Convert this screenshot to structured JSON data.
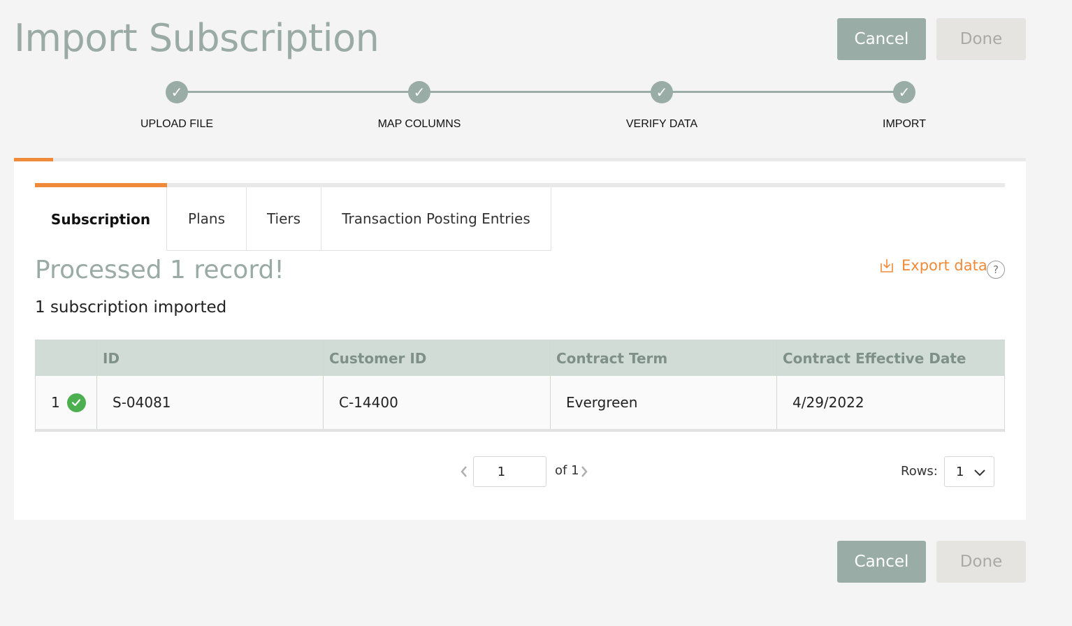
{
  "page": {
    "title": "Import Subscription"
  },
  "actions": {
    "cancel_label": "Cancel",
    "done_label": "Done"
  },
  "stepper": {
    "steps": [
      {
        "label": "UPLOAD FILE",
        "status": "complete"
      },
      {
        "label": "MAP COLUMNS",
        "status": "complete"
      },
      {
        "label": "VERIFY DATA",
        "status": "complete"
      },
      {
        "label": "IMPORT",
        "status": "complete"
      }
    ],
    "check_glyph": "✓"
  },
  "tabs": [
    {
      "label": "Subscription",
      "active": true
    },
    {
      "label": "Plans",
      "active": false
    },
    {
      "label": "Tiers",
      "active": false
    },
    {
      "label": "Transaction Posting Entries",
      "active": false
    }
  ],
  "result": {
    "title": "Processed 1 record!",
    "summary": "1 subscription imported",
    "export_label": "Export data",
    "help_glyph": "?"
  },
  "table": {
    "columns": [
      "ID",
      "Customer ID",
      "Contract Term",
      "Contract Effective Date"
    ],
    "rows": [
      {
        "index": "1",
        "status": "success",
        "cells": [
          "S-04081",
          "C-14400",
          "Evergreen",
          "4/29/2022"
        ]
      }
    ]
  },
  "pagination": {
    "current_page": "1",
    "of_label": "of 1",
    "rows_label": "Rows:",
    "rows_value": "1"
  },
  "colors": {
    "accent": "#ef8a3a",
    "primary_button": "#9aaca6",
    "success": "#4caf50",
    "header_bg": "#d1dcd6"
  }
}
